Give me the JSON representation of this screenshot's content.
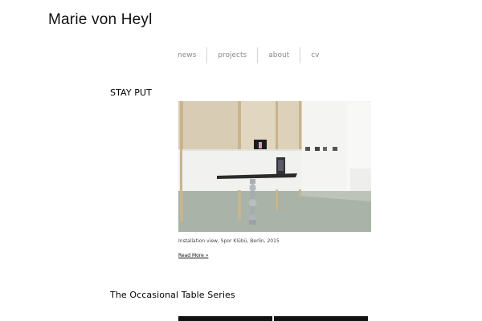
{
  "site": {
    "title": "Marie von Heyl"
  },
  "nav": {
    "items": [
      "news",
      "projects",
      "about",
      "cv"
    ]
  },
  "posts": [
    {
      "title": "STAY PUT",
      "image_alt": "installation-photo",
      "caption": "Installation view, Spor Klübü, Berlin, 2015",
      "read_more": "Read More »"
    },
    {
      "title": "The Occasional Table Series"
    }
  ]
}
